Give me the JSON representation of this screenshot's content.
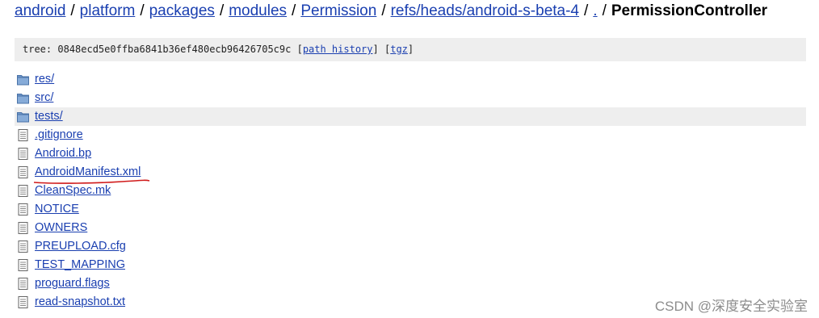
{
  "breadcrumb": {
    "items": [
      "android",
      "platform",
      "packages",
      "modules",
      "Permission",
      "refs/heads/android-s-beta-4",
      "."
    ],
    "separator": "/",
    "current": "PermissionController"
  },
  "tree": {
    "label": "tree:",
    "hash": "0848ecd5e0ffba6841b36ef480ecb96426705c9c",
    "path_history": "path history",
    "tgz": "tgz",
    "bracket_open": "[",
    "bracket_close": "]"
  },
  "files": [
    {
      "name": "res/",
      "type": "folder",
      "icon": "folder-icon"
    },
    {
      "name": "src/",
      "type": "folder",
      "icon": "folder-icon"
    },
    {
      "name": "tests/",
      "type": "folder",
      "icon": "folder-icon",
      "highlighted": true
    },
    {
      "name": ".gitignore",
      "type": "file",
      "icon": "file-icon"
    },
    {
      "name": "Android.bp",
      "type": "file",
      "icon": "file-icon"
    },
    {
      "name": "AndroidManifest.xml",
      "type": "file",
      "icon": "file-icon"
    },
    {
      "name": "CleanSpec.mk",
      "type": "file",
      "icon": "file-icon"
    },
    {
      "name": "NOTICE",
      "type": "file",
      "icon": "file-icon"
    },
    {
      "name": "OWNERS",
      "type": "file",
      "icon": "file-icon"
    },
    {
      "name": "PREUPLOAD.cfg",
      "type": "file",
      "icon": "file-icon"
    },
    {
      "name": "TEST_MAPPING",
      "type": "file",
      "icon": "file-icon"
    },
    {
      "name": "proguard.flags",
      "type": "file",
      "icon": "file-icon"
    },
    {
      "name": "read-snapshot.txt",
      "type": "file",
      "icon": "file-icon"
    }
  ],
  "watermark": "CSDN @深度安全实验室",
  "colors": {
    "link": "#1a3fb0",
    "folder": "#5a87c0",
    "annotation": "#d01a1a",
    "highlight_bg": "#eeeeee"
  }
}
